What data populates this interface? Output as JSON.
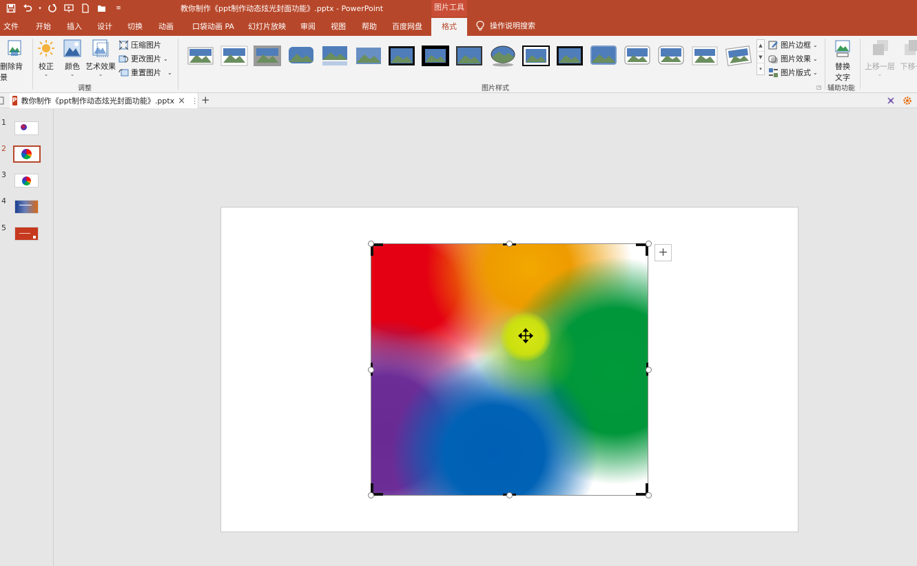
{
  "title_bar": {
    "title": "教你制作《ppt制作动态炫光封面功能》.pptx  -  PowerPoint",
    "context_tool": "图片工具"
  },
  "tabs": [
    {
      "label": "文件"
    },
    {
      "label": "开始"
    },
    {
      "label": "插入"
    },
    {
      "label": "设计"
    },
    {
      "label": "切换"
    },
    {
      "label": "动画"
    },
    {
      "label": "口袋动画 PA"
    },
    {
      "label": "幻灯片放映"
    },
    {
      "label": "审阅"
    },
    {
      "label": "视图"
    },
    {
      "label": "帮助"
    },
    {
      "label": "百度网盘"
    },
    {
      "label": "格式"
    }
  ],
  "tell_me": "操作说明搜索",
  "ribbon": {
    "remove_bg": "删除背景",
    "corrections": "校正",
    "color": "颜色",
    "artistic": "艺术效果",
    "compress": "压缩图片",
    "change": "更改图片",
    "reset": "重置图片",
    "adjust_group": "调整",
    "styles_group": "图片样式",
    "border": "图片边框",
    "effects": "图片效果",
    "layout": "图片版式",
    "alt_text_1": "替换",
    "alt_text_2": "文字",
    "accessibility_group": "辅助功能",
    "bring_forward": "上移一层",
    "send_backward": "下移一"
  },
  "document_tab": {
    "name": "教你制作《ppt制作动态炫光封面功能》.pptx"
  },
  "slides": [
    {
      "number": "1"
    },
    {
      "number": "2",
      "current": true
    },
    {
      "number": "3"
    },
    {
      "number": "4"
    },
    {
      "number": "5"
    }
  ],
  "colors": {
    "accent": "#b7472a",
    "ribbon_bg": "#f3f3f3",
    "canvas_bg": "#e6e6e6"
  }
}
